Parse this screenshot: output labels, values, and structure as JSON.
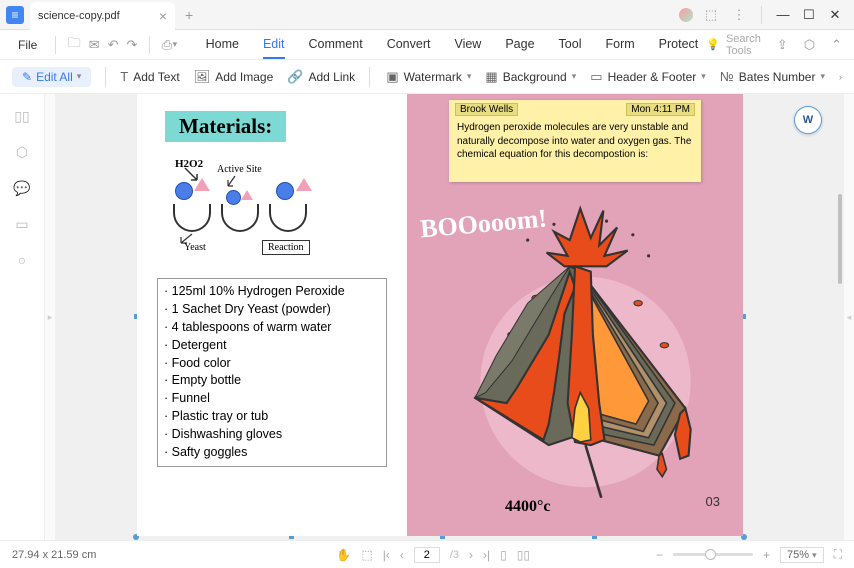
{
  "titlebar": {
    "filename": "science-copy.pdf",
    "logo": "≡"
  },
  "file_menu": {
    "label": "File"
  },
  "menu": {
    "home": "Home",
    "edit": "Edit",
    "comment": "Comment",
    "convert": "Convert",
    "view": "View",
    "page": "Page",
    "tool": "Tool",
    "form": "Form",
    "protect": "Protect"
  },
  "search": {
    "placeholder": "Search Tools"
  },
  "toolbar": {
    "edit_all": "Edit All",
    "add_text": "Add Text",
    "add_image": "Add Image",
    "add_link": "Add Link",
    "watermark": "Watermark",
    "background": "Background",
    "header_footer": "Header & Footer",
    "bates": "Bates Number"
  },
  "document": {
    "materials_title": "Materials:",
    "labels": {
      "h2o2": "H2O2",
      "yeast": "Yeast",
      "active_site": "Active Site",
      "reaction": "Reaction"
    },
    "materials_list": [
      "125ml 10% Hydrogen Peroxide",
      "1 Sachet Dry Yeast (powder)",
      "4 tablespoons of warm water",
      "Detergent",
      "Food color",
      "Empty bottle",
      "Funnel",
      "Plastic tray or tub",
      "Dishwashing gloves",
      "Safty goggles"
    ],
    "sticky": {
      "author": "Brook Wells",
      "time": "Mon 4:11 PM",
      "text": "Hydrogen peroxide molecules are very unstable and naturally decompose into water and oxygen gas. The chemical equation for this decompostion is:"
    },
    "boom": "BOOooom!",
    "temp": "4400°c",
    "page_number": "03"
  },
  "status": {
    "dimensions": "27.94 x 21.59 cm",
    "current_page": "2",
    "total_pages": "/3",
    "zoom": "75%"
  },
  "word_btn": "W"
}
